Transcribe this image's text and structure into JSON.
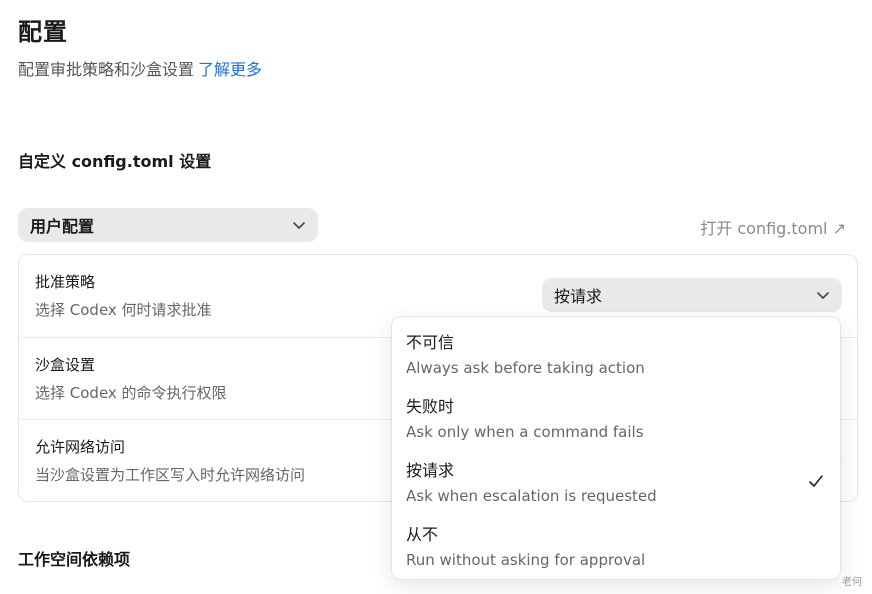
{
  "header": {
    "title": "配置",
    "subtitle": "配置审批策略和沙盒设置",
    "learn_more": "了解更多"
  },
  "custom_section": {
    "title": "自定义 config.toml 设置",
    "profile_select": "用户配置",
    "open_config": "打开 config.toml ↗"
  },
  "settings": [
    {
      "title": "批准策略",
      "description": "选择 Codex 何时请求批准"
    },
    {
      "title": "沙盒设置",
      "description": "选择 Codex 的命令执行权限"
    },
    {
      "title": "允许网络访问",
      "description": "当沙盒设置为工作区写入时允许网络访问"
    }
  ],
  "approval_select": {
    "value": "按请求"
  },
  "dropdown": {
    "options": [
      {
        "label": "不可信",
        "description": "Always ask before taking action",
        "selected": false
      },
      {
        "label": "失败时",
        "description": "Ask only when a command fails",
        "selected": false
      },
      {
        "label": "按请求",
        "description": "Ask when escalation is requested",
        "selected": true
      },
      {
        "label": "从不",
        "description": "Run without asking for approval",
        "selected": false
      }
    ]
  },
  "workspace_section": {
    "title": "工作空间依赖项"
  },
  "watermark": "老何",
  "colors": {
    "link": "#1a73d9",
    "select_bg": "#e9e9e9"
  }
}
